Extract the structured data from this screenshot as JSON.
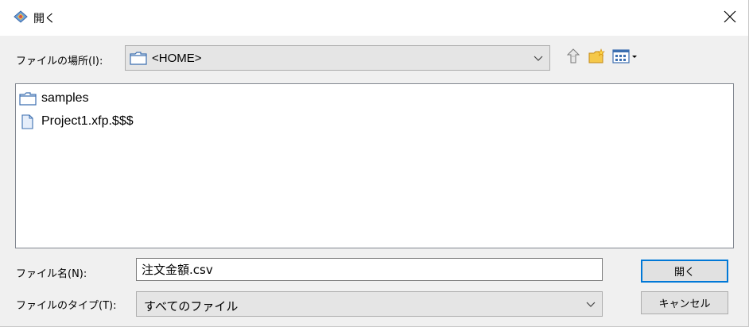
{
  "window": {
    "title": "開く",
    "title_icon": "app-icon",
    "close_icon": "close-icon"
  },
  "look_in": {
    "label": "ファイルの場所(I):",
    "value": "<HOME>",
    "icon": "folder-icon"
  },
  "toolbar": {
    "up_icon": "up-one-level-icon",
    "new_folder_icon": "new-folder-icon",
    "view_menu_icon": "view-menu-icon"
  },
  "files": [
    {
      "name": "samples",
      "icon": "folder-icon"
    },
    {
      "name": "Project1.xfp.$$$",
      "icon": "file-icon"
    }
  ],
  "file_name": {
    "label": "ファイル名(N):",
    "value": "注文金額.csv"
  },
  "file_type": {
    "label": "ファイルのタイプ(T):",
    "value": "すべてのファイル"
  },
  "buttons": {
    "open": "開く",
    "cancel": "キャンセル"
  },
  "colors": {
    "dialog_bg": "#f0f0f0",
    "focus_border": "#0078d7",
    "folder_blue": "#3c6fb0"
  }
}
